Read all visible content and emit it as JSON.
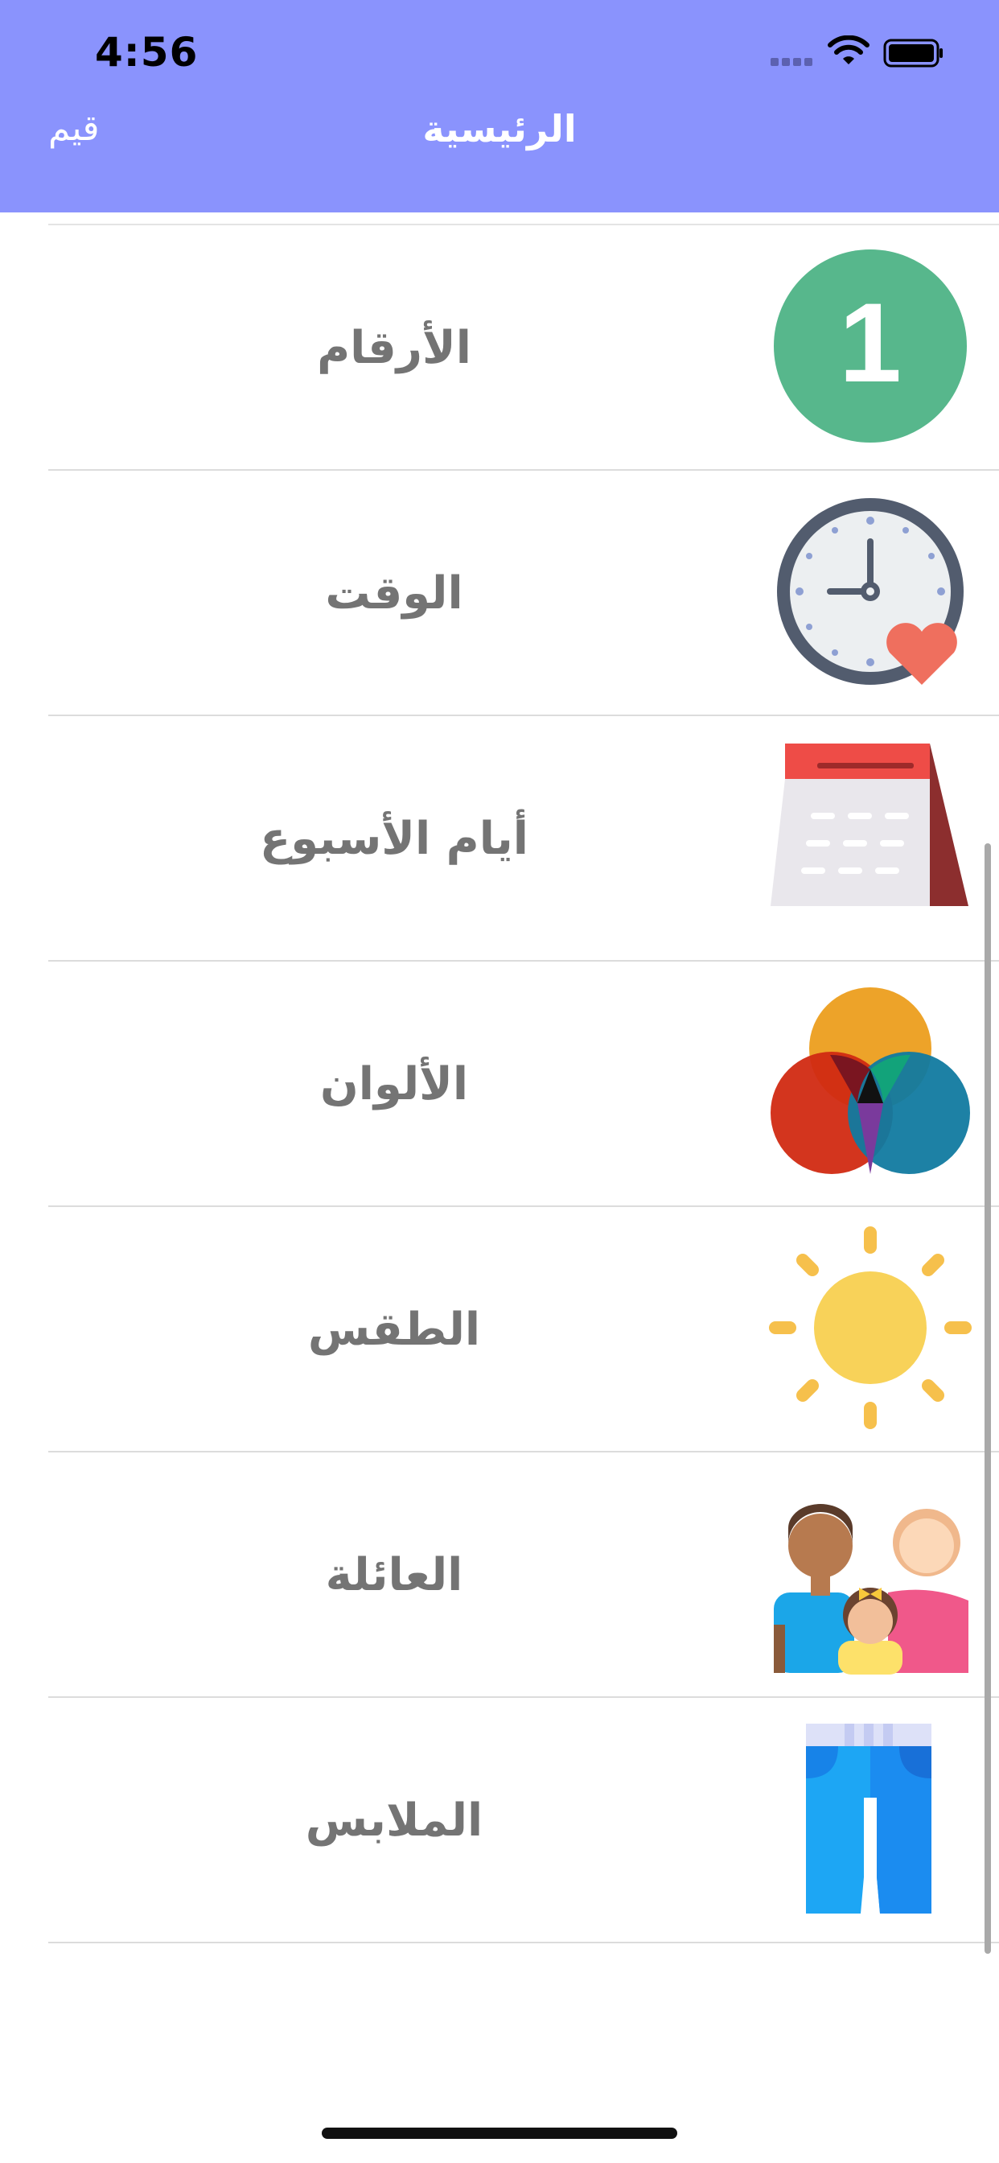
{
  "status_bar": {
    "time": "4:56"
  },
  "nav": {
    "title": "الرئيسية",
    "rate_label": "قيم",
    "background": "#8a93fd"
  },
  "categories": [
    {
      "label": "الأرقام",
      "icon": "number-one-icon"
    },
    {
      "label": "الوقت",
      "icon": "clock-heart-icon"
    },
    {
      "label": "أيام الأسبوع",
      "icon": "calendar-icon"
    },
    {
      "label": "الألوان",
      "icon": "color-circles-icon"
    },
    {
      "label": "الطقس",
      "icon": "sun-icon"
    },
    {
      "label": "العائلة",
      "icon": "family-icon"
    },
    {
      "label": "الملابس",
      "icon": "pants-icon"
    }
  ],
  "icon_glyphs": {
    "number": "1"
  }
}
